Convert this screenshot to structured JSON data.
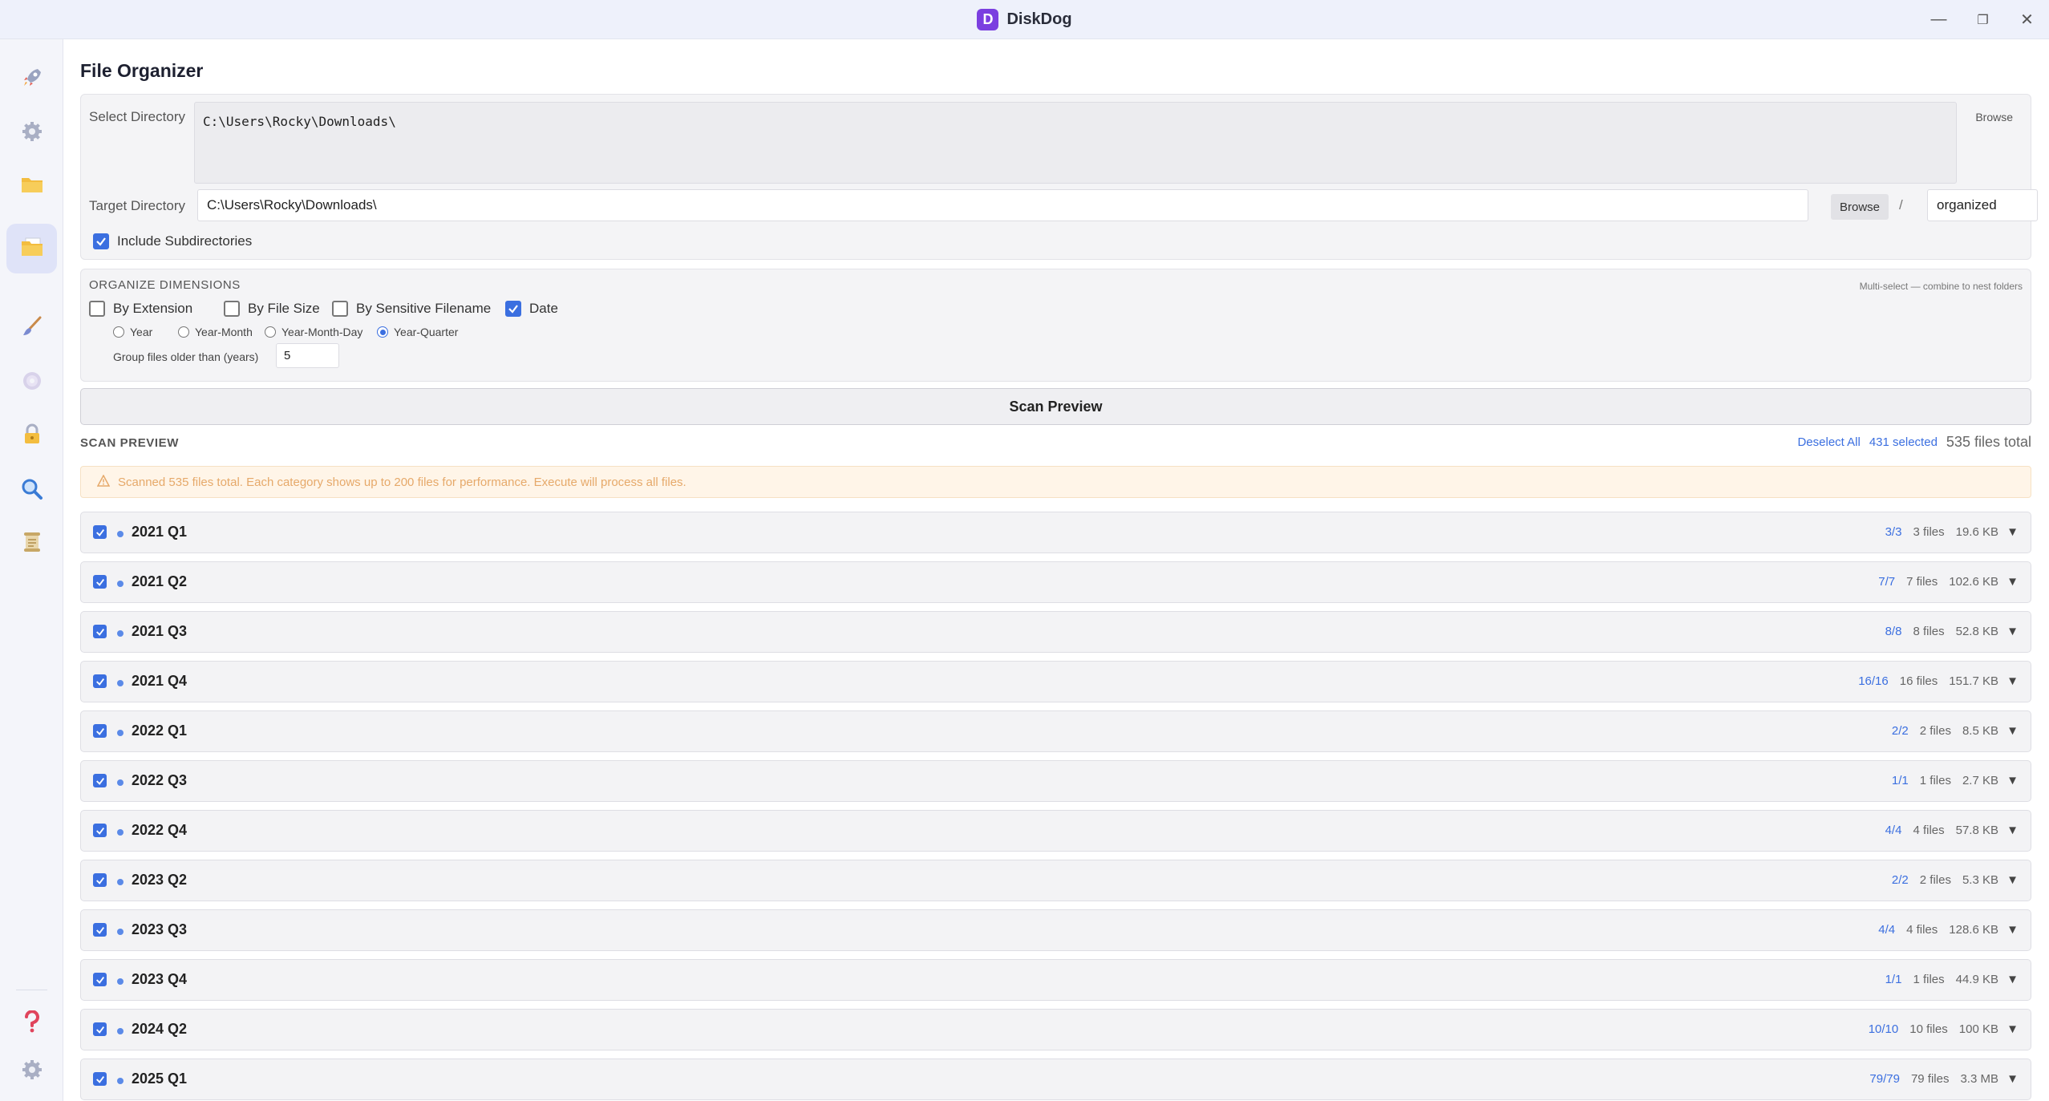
{
  "app": {
    "title": "DiskDog",
    "logo_letter": "D"
  },
  "window_controls": {
    "minimize": "—",
    "maximize": "❐",
    "close": "✕"
  },
  "sidebar": {
    "items": [
      {
        "icon": "rocket-icon"
      },
      {
        "icon": "gear-icon"
      },
      {
        "icon": "folder-icon"
      },
      {
        "icon": "file-organizer-icon",
        "active": true
      },
      {
        "icon": "brush-icon"
      },
      {
        "icon": "disc-icon"
      },
      {
        "icon": "lock-icon"
      },
      {
        "icon": "magnifier-icon"
      },
      {
        "icon": "scroll-icon"
      }
    ],
    "bottom": [
      {
        "icon": "help-icon"
      },
      {
        "icon": "settings-icon"
      }
    ]
  },
  "page": {
    "title": "File Organizer"
  },
  "directories": {
    "select_label": "Select Directory",
    "select_value": "C:\\Users\\Rocky\\Downloads\\",
    "select_browse": "Browse",
    "target_label": "Target Directory",
    "target_value": "C:\\Users\\Rocky\\Downloads\\",
    "target_browse": "Browse",
    "separator": "/",
    "subfolder_value": "organized",
    "include_subdirs_label": "Include Subdirectories",
    "include_subdirs_checked": true
  },
  "organize": {
    "heading": "ORGANIZE DIMENSIONS",
    "hint": "Multi-select — combine to nest folders",
    "dimensions": [
      {
        "label": "By Extension",
        "checked": false
      },
      {
        "label": "By File Size",
        "checked": false
      },
      {
        "label": "By Sensitive Filename",
        "checked": false
      },
      {
        "label": "Date",
        "checked": true
      }
    ],
    "date_modes": [
      {
        "label": "Year",
        "checked": false
      },
      {
        "label": "Year-Month",
        "checked": false
      },
      {
        "label": "Year-Month-Day",
        "checked": false
      },
      {
        "label": "Year-Quarter",
        "checked": true
      }
    ],
    "group_older_label": "Group files older than (years)",
    "group_older_value": "5"
  },
  "scan": {
    "button_label": "Scan Preview"
  },
  "preview": {
    "heading": "SCAN PREVIEW",
    "deselect_all": "Deselect All",
    "selected": "431 selected",
    "total": "535 files total",
    "warning": "Scanned 535 files total. Each category shows up to 200 files for performance. Execute will process all files.",
    "categories": [
      {
        "name": "2021 Q1",
        "selected": "3/3",
        "files": "3 files",
        "size": "19.6 KB"
      },
      {
        "name": "2021 Q2",
        "selected": "7/7",
        "files": "7 files",
        "size": "102.6 KB"
      },
      {
        "name": "2021 Q3",
        "selected": "8/8",
        "files": "8 files",
        "size": "52.8 KB"
      },
      {
        "name": "2021 Q4",
        "selected": "16/16",
        "files": "16 files",
        "size": "151.7 KB"
      },
      {
        "name": "2022 Q1",
        "selected": "2/2",
        "files": "2 files",
        "size": "8.5 KB"
      },
      {
        "name": "2022 Q3",
        "selected": "1/1",
        "files": "1 files",
        "size": "2.7 KB"
      },
      {
        "name": "2022 Q4",
        "selected": "4/4",
        "files": "4 files",
        "size": "57.8 KB"
      },
      {
        "name": "2023 Q2",
        "selected": "2/2",
        "files": "2 files",
        "size": "5.3 KB"
      },
      {
        "name": "2023 Q3",
        "selected": "4/4",
        "files": "4 files",
        "size": "128.6 KB"
      },
      {
        "name": "2023 Q4",
        "selected": "1/1",
        "files": "1 files",
        "size": "44.9 KB"
      },
      {
        "name": "2024 Q2",
        "selected": "10/10",
        "files": "10 files",
        "size": "100 KB"
      },
      {
        "name": "2025 Q1",
        "selected": "79/79",
        "files": "79 files",
        "size": "3.3 MB"
      }
    ]
  }
}
